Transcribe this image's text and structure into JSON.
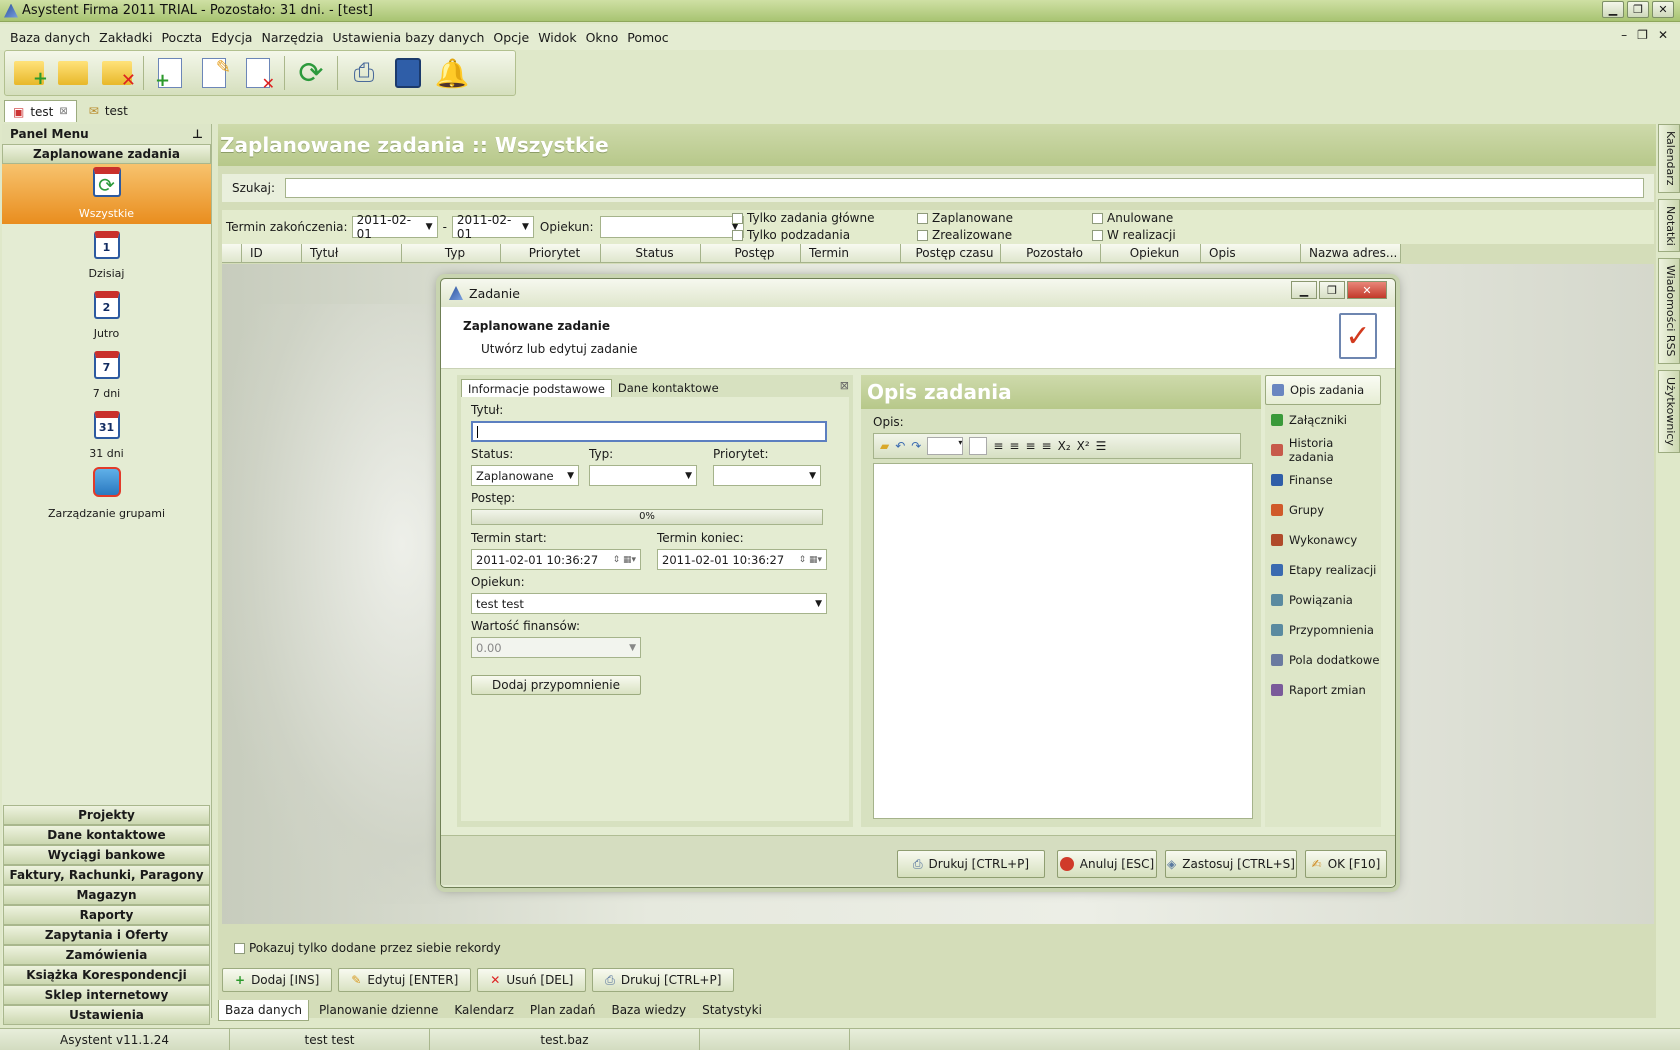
{
  "window": {
    "title": "Asystent Firma 2011 TRIAL - Pozostało: 31 dni. - [test]"
  },
  "menu": [
    "Baza danych",
    "Zakładki",
    "Poczta",
    "Edycja",
    "Narzędzia",
    "Ustawienia bazy danych",
    "Opcje",
    "Widok",
    "Okno",
    "Pomoc"
  ],
  "doc_tabs": [
    "test",
    "test"
  ],
  "panel": {
    "title": "Panel Menu",
    "group": "Zaplanowane zadania",
    "items": [
      {
        "label": "Wszystkie",
        "icon": "refresh-calendar-icon"
      },
      {
        "label": "Dzisiaj",
        "num": "1"
      },
      {
        "label": "Jutro",
        "num": "2"
      },
      {
        "label": "7 dni",
        "num": "7"
      },
      {
        "label": "31 dni",
        "num": "31"
      },
      {
        "label": "Zarządzanie grupami",
        "icon": "groups-icon"
      }
    ],
    "sections": [
      "Projekty",
      "Dane kontaktowe",
      "Wyciągi bankowe",
      "Faktury, Rachunki, Paragony",
      "Magazyn",
      "Raporty",
      "Zapytania i Oferty",
      "Zamówienia",
      "Książka Korespondencji",
      "Sklep internetowy",
      "Ustawienia"
    ]
  },
  "main": {
    "title": "Zaplanowane zadania :: Wszystkie",
    "search_label": "Szukaj:",
    "filters": {
      "date_label": "Termin zakończenia:",
      "date_from": "2011-02-01",
      "sep": "-",
      "date_to": "2011-02-01",
      "owner_label": "Opiekun:",
      "checks": [
        "Tylko zadania główne",
        "Tylko podzadania",
        "Zaplanowane",
        "Zrealizowane",
        "Anulowane",
        "W realizacji"
      ]
    },
    "columns": [
      "ID",
      "Tytuł",
      "Typ",
      "Priorytet",
      "Status",
      "Postęp",
      "Termin rozpoc...",
      "Postęp czasu",
      "Pozostało",
      "Opiekun",
      "Opis",
      "Nazwa adres..."
    ],
    "only_mine": "Pokazuj tylko dodane przez siebie rekordy",
    "actions": [
      "Dodaj [INS]",
      "Edytuj [ENTER]",
      "Usuń [DEL]",
      "Drukuj [CTRL+P]"
    ],
    "bottom_tabs": [
      "Baza danych",
      "Planowanie dzienne",
      "Kalendarz",
      "Plan zadań",
      "Baza wiedzy",
      "Statystyki"
    ]
  },
  "side_tabs": [
    "Kalendarz",
    "Notatki",
    "Wiadomości RSS",
    "Użytkownicy"
  ],
  "status": [
    "Asystent v11.1.24",
    "test test",
    "test.baz"
  ],
  "dialog": {
    "title": "Zadanie",
    "heading": "Zaplanowane zadanie",
    "subheading": "Utwórz lub edytuj zadanie",
    "tabs": [
      "Informacje podstawowe",
      "Dane kontaktowe"
    ],
    "form": {
      "title_label": "Tytuł:",
      "status_label": "Status:",
      "status_value": "Zaplanowane",
      "type_label": "Typ:",
      "priority_label": "Priorytet:",
      "progress_label": "Postęp:",
      "progress_value": "0%",
      "progress": 0,
      "start_label": "Termin start:",
      "start_value": "2011-02-01  10:36:27",
      "end_label": "Termin koniec:",
      "end_value": "2011-02-01  10:36:27",
      "owner_label": "Opiekun:",
      "owner_value": "test test",
      "finance_label": "Wartość finansów:",
      "finance_value": "0.00",
      "reminder_button": "Dodaj przypomnienie"
    },
    "desc_header": "Opis zadania",
    "desc_label": "Opis:",
    "nav": [
      {
        "label": "Opis zadania",
        "color": "#6a86c0"
      },
      {
        "label": "Załączniki",
        "color": "#3a9a3a"
      },
      {
        "label": "Historia zadania",
        "color": "#c75a4a"
      },
      {
        "label": "Finanse",
        "color": "#2f5ea8"
      },
      {
        "label": "Grupy",
        "color": "#d05a2a"
      },
      {
        "label": "Wykonawcy",
        "color": "#b04a2a"
      },
      {
        "label": "Etapy realizacji",
        "color": "#3a6ab0"
      },
      {
        "label": "Powiązania",
        "color": "#5a8aa0"
      },
      {
        "label": "Przypomnienia",
        "color": "#5a8aa0"
      },
      {
        "label": "Pola dodatkowe",
        "color": "#6a7aa0"
      },
      {
        "label": "Raport zmian",
        "color": "#7a5a9a"
      }
    ],
    "footer": [
      "Drukuj [CTRL+P]",
      "Anuluj [ESC]",
      "Zastosuj [CTRL+S]",
      "OK [F10]"
    ]
  }
}
